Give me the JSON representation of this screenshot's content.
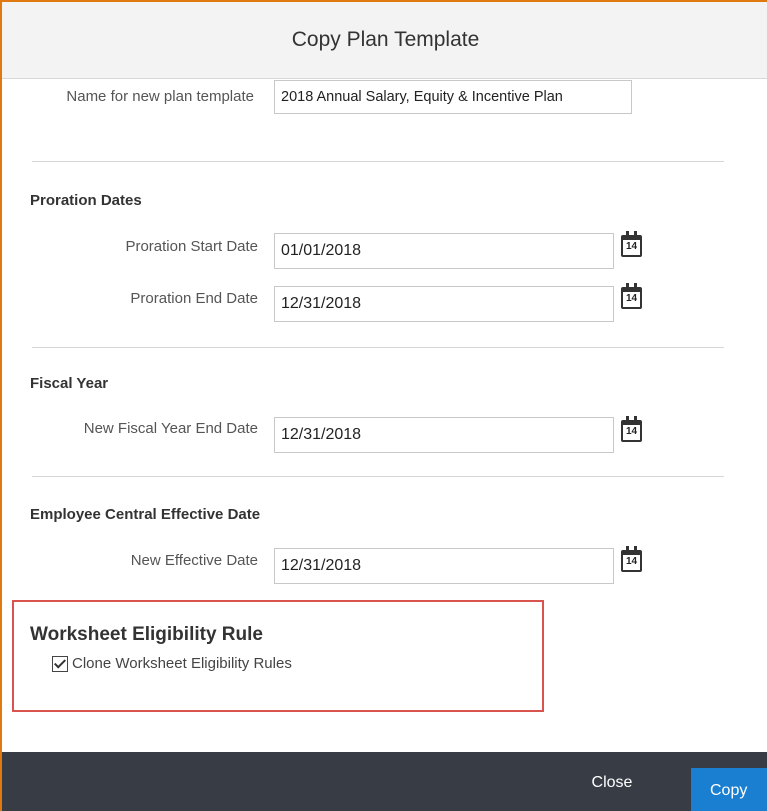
{
  "dialog": {
    "title": "Copy Plan Template"
  },
  "name_field": {
    "label": "Name for new plan template",
    "value": "2018 Annual Salary, Equity & Incentive Plan"
  },
  "proration": {
    "title": "Proration Dates",
    "start_label": "Proration Start Date",
    "start_value": "01/01/2018",
    "end_label": "Proration End Date",
    "end_value": "12/31/2018"
  },
  "fiscal": {
    "title": "Fiscal Year",
    "label": "New Fiscal Year End Date",
    "value": "12/31/2018"
  },
  "ec": {
    "title": "Employee Central Effective Date",
    "label": "New Effective Date",
    "value": "12/31/2018"
  },
  "calendar": {
    "glyph": "14",
    "icon": "calendar-icon"
  },
  "eligibility": {
    "title": "Worksheet Eligibility Rule",
    "checkbox_label": "Clone Worksheet Eligibility Rules",
    "checked": true
  },
  "footer": {
    "close_label": "Close",
    "copy_label": "Copy"
  },
  "colors": {
    "highlight_border": "#d9534f",
    "footer_bg": "#383d45",
    "primary": "#1a7fd1",
    "dialog_border": "#e07a10"
  }
}
